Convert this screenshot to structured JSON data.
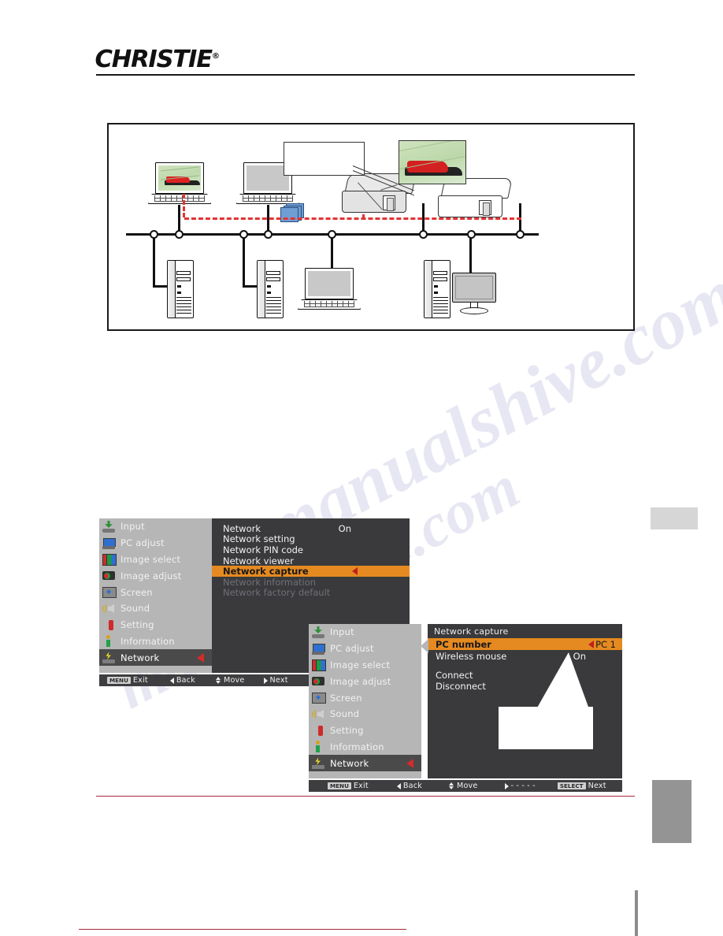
{
  "header": {
    "brand": "CHRISTIE",
    "brand_mark": "®"
  },
  "figure": {
    "name": "network-capture-diagram",
    "callout_label": "",
    "devices": {
      "laptop_source": "laptop-with-image",
      "laptop_idle": "laptop",
      "tower": "desktop-tower",
      "monitor": "crt-monitor",
      "projector_active": "projector",
      "projector_idle": "projector",
      "projected_image": "race-car-image",
      "data_packets": "blue-document-stack"
    }
  },
  "menu_main": {
    "sidebar": [
      {
        "label": "Input",
        "icon": "input-icon",
        "selected": false
      },
      {
        "label": "PC adjust",
        "icon": "pc-adjust-icon",
        "selected": false
      },
      {
        "label": "Image select",
        "icon": "image-select-icon",
        "selected": false
      },
      {
        "label": "Image adjust",
        "icon": "image-adjust-icon",
        "selected": false
      },
      {
        "label": "Screen",
        "icon": "screen-icon",
        "selected": false
      },
      {
        "label": "Sound",
        "icon": "sound-icon",
        "selected": false
      },
      {
        "label": "Setting",
        "icon": "setting-icon",
        "selected": false
      },
      {
        "label": "Information",
        "icon": "information-icon",
        "selected": false
      },
      {
        "label": "Network",
        "icon": "network-icon",
        "selected": true
      }
    ],
    "items": [
      {
        "label": "Network",
        "value": "On",
        "state": "normal"
      },
      {
        "label": "Network setting",
        "value": "",
        "state": "normal"
      },
      {
        "label": "Network PIN code",
        "value": "",
        "state": "normal"
      },
      {
        "label": "Network viewer",
        "value": "",
        "state": "normal"
      },
      {
        "label": "Network capture",
        "value": "",
        "state": "highlighted"
      },
      {
        "label": "Network information",
        "value": "",
        "state": "disabled"
      },
      {
        "label": "Network factory default",
        "value": "",
        "state": "disabled"
      }
    ],
    "footbar": {
      "exit_key": "MENU",
      "exit_label": "Exit",
      "back_label": "Back",
      "move_label": "Move",
      "next_label": "Next"
    }
  },
  "menu_capture": {
    "sidebar": [
      {
        "label": "Input",
        "icon": "input-icon",
        "selected": false
      },
      {
        "label": "PC adjust",
        "icon": "pc-adjust-icon",
        "selected": false
      },
      {
        "label": "Image select",
        "icon": "image-select-icon",
        "selected": false
      },
      {
        "label": "Image adjust",
        "icon": "image-adjust-icon",
        "selected": false
      },
      {
        "label": "Screen",
        "icon": "screen-icon",
        "selected": false
      },
      {
        "label": "Sound",
        "icon": "sound-icon",
        "selected": false
      },
      {
        "label": "Setting",
        "icon": "setting-icon",
        "selected": false
      },
      {
        "label": "Information",
        "icon": "information-icon",
        "selected": false
      },
      {
        "label": "Network",
        "icon": "network-icon",
        "selected": true
      }
    ],
    "title": "Network capture",
    "items": [
      {
        "label": "PC number",
        "value": "PC 1",
        "state": "highlighted"
      },
      {
        "label": "Wireless mouse",
        "value": "On",
        "state": "normal"
      },
      {
        "label": "",
        "value": "",
        "state": "spacer"
      },
      {
        "label": "Connect",
        "value": "",
        "state": "normal"
      },
      {
        "label": "Disconnect",
        "value": "",
        "state": "normal"
      }
    ],
    "callout_label": "",
    "footbar": {
      "exit_key": "MENU",
      "exit_label": "Exit",
      "back_label": "Back",
      "move_label": "Move",
      "dash_label": "- - - - -",
      "select_key": "SELECT",
      "next_label": "Next"
    }
  },
  "colors": {
    "highlight": "#e58a20",
    "sidebar_bg": "#b6b6b6",
    "panel_bg": "#3a3a3c",
    "selected_row": "#4a4a4a",
    "arrow_red": "#d42b2b",
    "flow_red": "#e23434",
    "footer_rule": "#a8293f"
  },
  "watermark": {
    "text_1": "manualshive.com",
    "text_2": "manualshive.com"
  }
}
